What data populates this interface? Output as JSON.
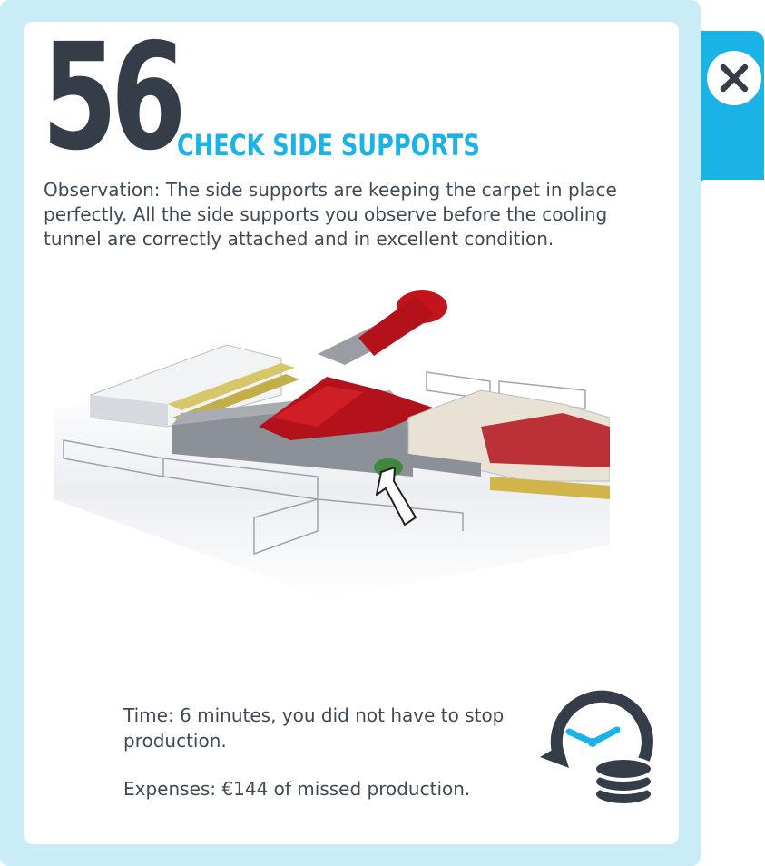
{
  "card": {
    "number": "56",
    "title": "CHECK SIDE SUPPORTS",
    "observation": "Observation: The side supports are keeping the carpet in place perfectly. All the side supports you observe before the cooling tunnel are correctly attached and in excellent condition.",
    "time": "Time: 6 minutes, you did not have to stop production.",
    "expenses": "Expenses: €144 of missed production."
  },
  "icons": {
    "close": "close-icon",
    "time_cost": "clock-coins-icon",
    "pointer": "arrow-pointer-icon"
  },
  "colors": {
    "accent": "#1bb2e5",
    "frame": "#c9ecf7",
    "dark_text": "#343d48",
    "body_text": "#404a55",
    "carpet_red": "#b3121b",
    "highlight_green": "#3f8a3a"
  }
}
